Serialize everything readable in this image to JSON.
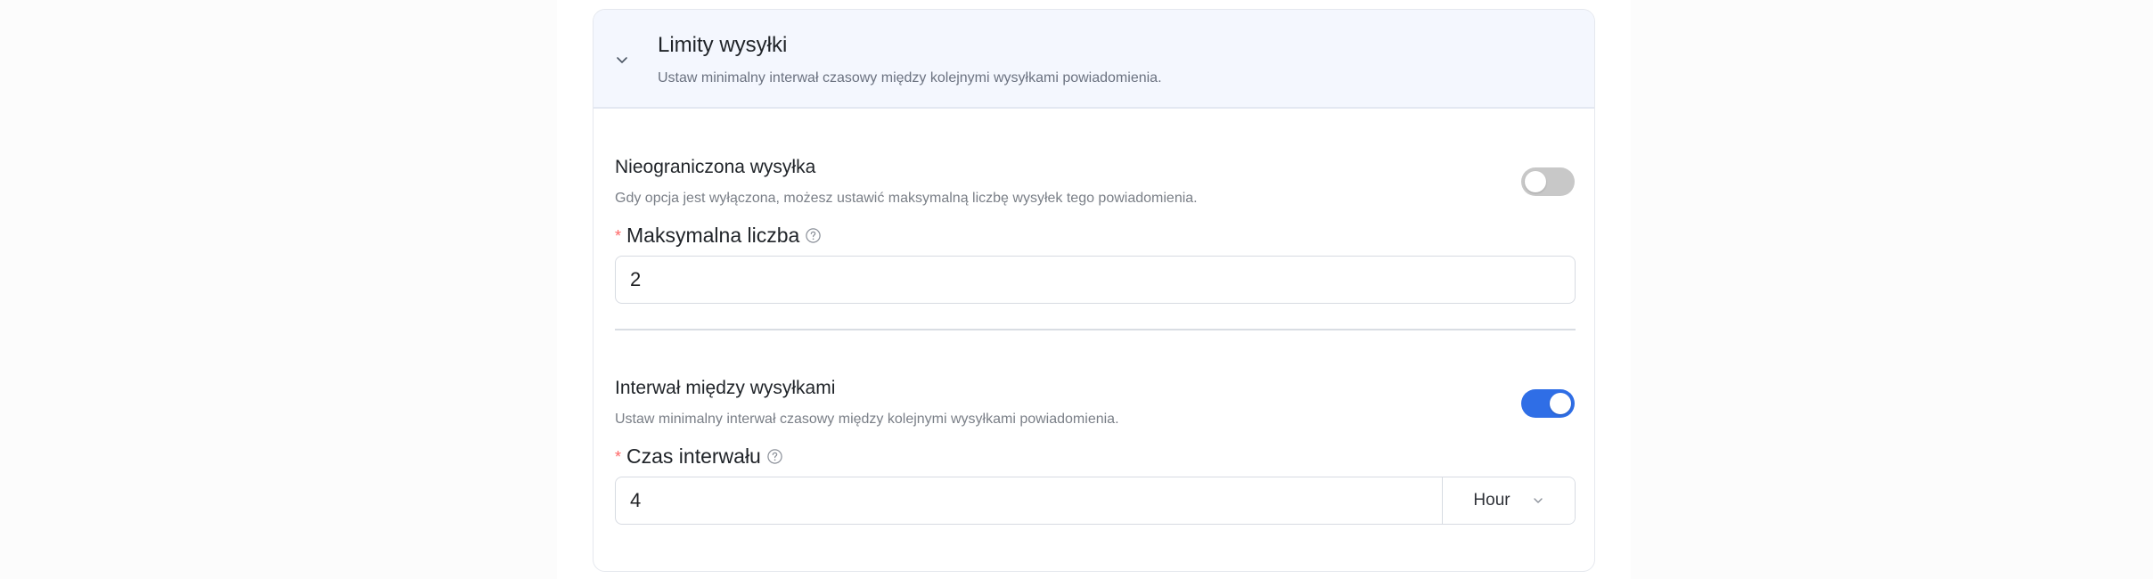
{
  "header": {
    "title": "Limity wysyłki",
    "subtitle": "Ustaw minimalny interwał czasowy między kolejnymi wysyłkami powiadomienia.",
    "chevron_icon": "chevron-down-icon"
  },
  "unlimited_sending": {
    "title": "Nieograniczona wysyłka",
    "description": "Gdy opcja jest wyłączona, możesz ustawić maksymalną liczbę wysyłek tego powiadomienia.",
    "toggle_state": "off"
  },
  "max_count": {
    "required_marker": "*",
    "label": "Maksymalna liczba",
    "help_icon": "help-circle-icon",
    "value": "2"
  },
  "interval_sending": {
    "title": "Interwał między wysyłkami",
    "description": "Ustaw minimalny interwał czasowy między kolejnymi wysyłkami powiadomienia.",
    "toggle_state": "on"
  },
  "interval_time": {
    "required_marker": "*",
    "label": "Czas interwału",
    "help_icon": "help-circle-icon",
    "value": "4",
    "unit": "Hour",
    "unit_icon": "chevron-down-icon"
  },
  "colors": {
    "accent": "#2f6ee6",
    "header_bg": "#f4f7fe",
    "required": "#ff6666",
    "toggle_off": "#c8c8c8"
  }
}
